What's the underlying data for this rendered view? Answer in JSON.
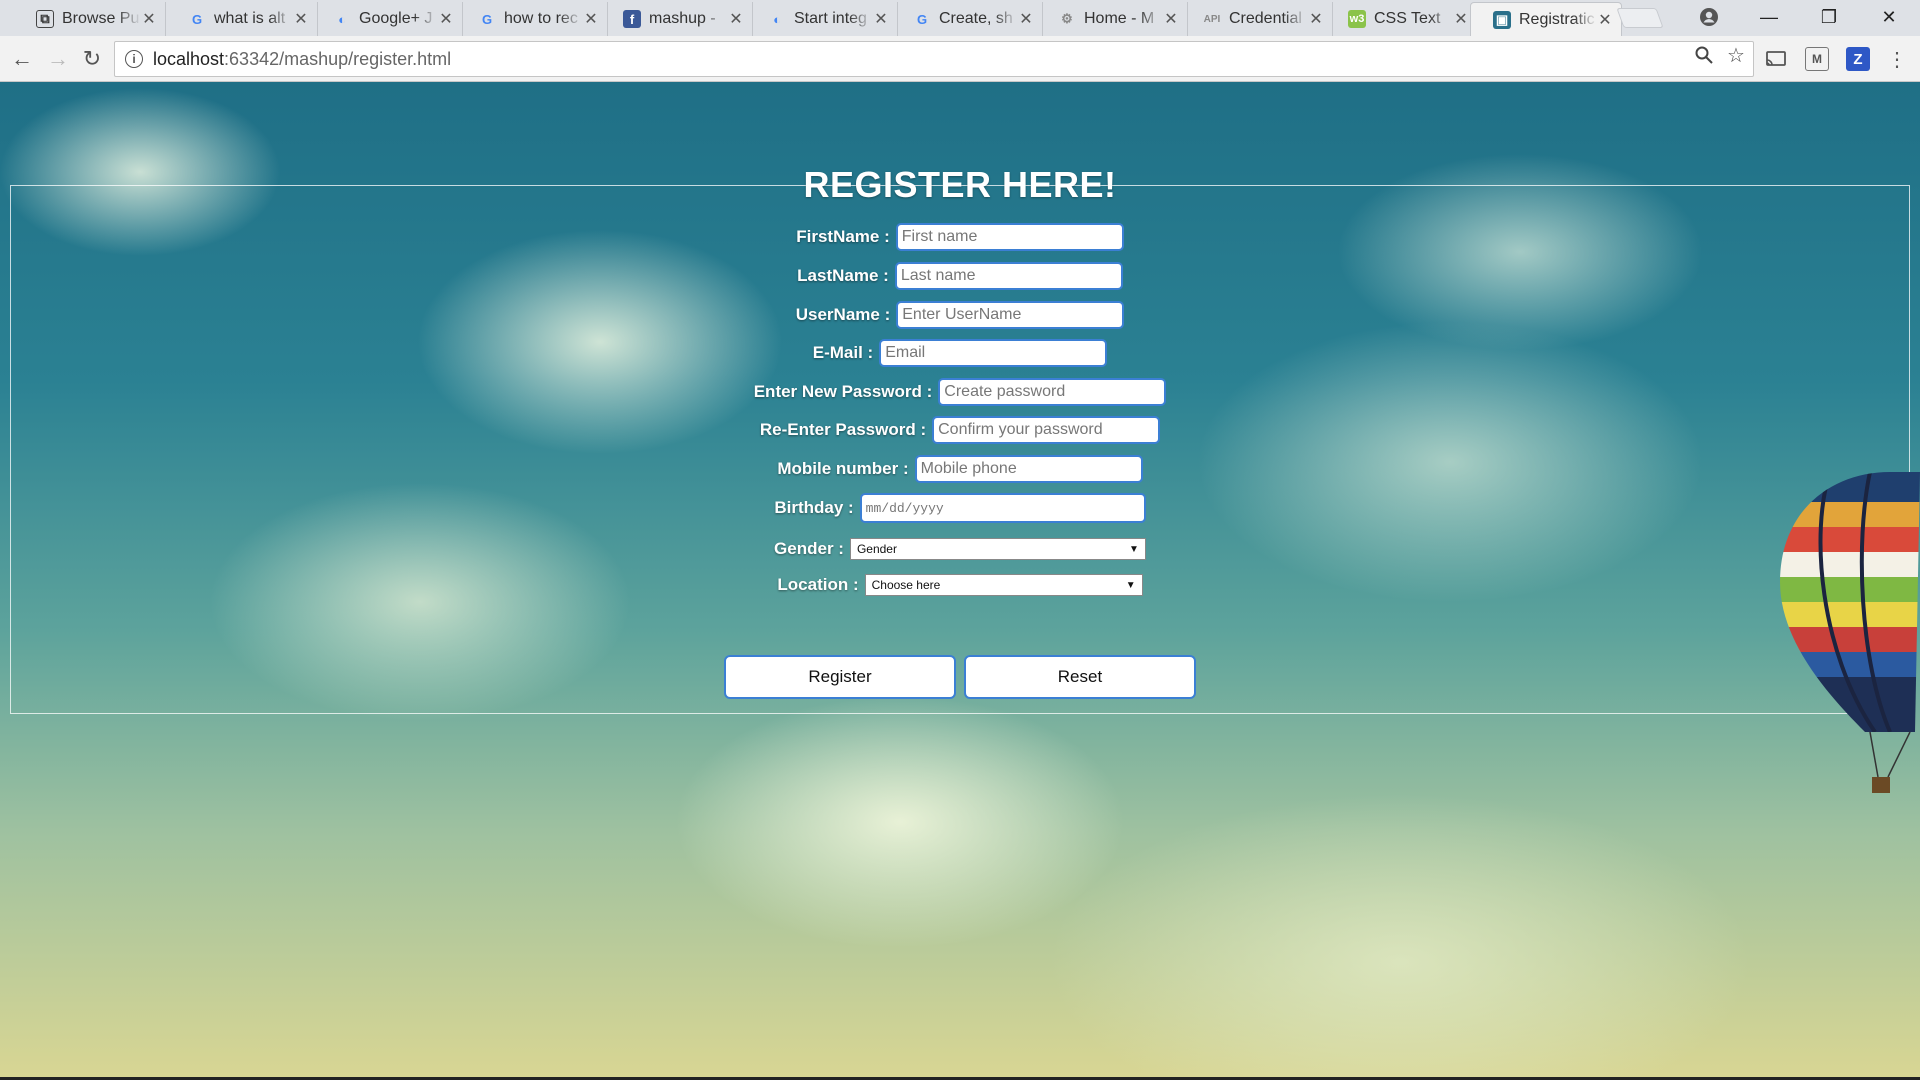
{
  "browser": {
    "tabs": [
      {
        "title": "Browse Pu",
        "icon": "page-icon",
        "active": false
      },
      {
        "title": "what is alt",
        "icon": "google-icon",
        "active": false
      },
      {
        "title": "Google+ J",
        "icon": "chrome-icon",
        "active": false
      },
      {
        "title": "how to rec",
        "icon": "google-icon",
        "active": false
      },
      {
        "title": "mashup -",
        "icon": "facebook-icon",
        "active": false
      },
      {
        "title": "Start integ",
        "icon": "chrome-icon",
        "active": false
      },
      {
        "title": "Create, sh",
        "icon": "google-icon",
        "active": false
      },
      {
        "title": "Home - M",
        "icon": "gear-icon",
        "active": false
      },
      {
        "title": "Credential",
        "icon": "api-icon",
        "icon_text": "API",
        "active": false
      },
      {
        "title": "CSS Text",
        "icon": "w3-icon",
        "icon_text": "w3",
        "active": false
      },
      {
        "title": "Registratic",
        "icon": "page-icon",
        "active": true
      }
    ],
    "url": {
      "host": "localhost",
      "rest": ":63342/mashup/register.html"
    }
  },
  "form": {
    "title": "REGISTER HERE!",
    "fields": [
      {
        "label": "FirstName :",
        "placeholder": "First name"
      },
      {
        "label": "LastName :",
        "placeholder": "Last name"
      },
      {
        "label": "UserName :",
        "placeholder": "Enter UserName"
      },
      {
        "label": "E-Mail :",
        "placeholder": "Email"
      },
      {
        "label": "Enter New Password :",
        "placeholder": "Create password"
      },
      {
        "label": "Re-Enter Password :",
        "placeholder": "Confirm your password"
      },
      {
        "label": "Mobile number :",
        "placeholder": "Mobile phone"
      },
      {
        "label": "Birthday :",
        "placeholder": "mm/dd/yyyy"
      }
    ],
    "gender": {
      "label": "Gender :",
      "selected": "Gender"
    },
    "location": {
      "label": "Location :",
      "selected": "Choose here"
    },
    "register_label": "Register",
    "reset_label": "Reset"
  },
  "colors": {
    "input_border": "#3b7fd4",
    "label_text": "#ffffff",
    "sky_top": "#1f6f86",
    "sky_bottom": "#d9d693"
  }
}
